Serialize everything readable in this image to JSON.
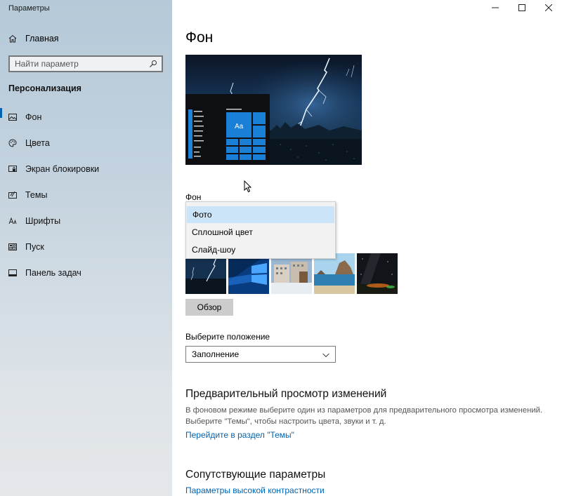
{
  "window": {
    "title": "Параметры",
    "controls": {
      "minimize": "—",
      "maximize": "☐",
      "close": "✕"
    }
  },
  "sidebar": {
    "home_label": "Главная",
    "search_placeholder": "Найти параметр",
    "section_heading": "Персонализация",
    "items": [
      {
        "label": "Фон",
        "icon": "picture-icon",
        "active": true
      },
      {
        "label": "Цвета",
        "icon": "palette-icon",
        "active": false
      },
      {
        "label": "Экран блокировки",
        "icon": "lock-screen-icon",
        "active": false
      },
      {
        "label": "Темы",
        "icon": "themes-icon",
        "active": false
      },
      {
        "label": "Шрифты",
        "icon": "fonts-icon",
        "active": false
      },
      {
        "label": "Пуск",
        "icon": "start-icon",
        "active": false
      },
      {
        "label": "Панель задач",
        "icon": "taskbar-icon",
        "active": false
      }
    ]
  },
  "main": {
    "title": "Фон",
    "preview_tile_text": "Aa",
    "background_label": "Фон",
    "background_options": [
      "Фото",
      "Сплошной цвет",
      "Слайд-шоу"
    ],
    "background_selected": "Фото",
    "browse_button": "Обзор",
    "fit_label": "Выберите положение",
    "fit_value": "Заполнение",
    "preview_changes_heading": "Предварительный просмотр изменений",
    "preview_changes_desc_1": "В фоновом режиме выберите один из параметров для предварительного просмотра изменений.",
    "preview_changes_desc_2": "Выберите \"Темы\", чтобы настроить цвета, звуки и т. д.",
    "themes_link": "Перейдите в раздел \"Темы\"",
    "related_heading": "Сопутствующие параметры",
    "high_contrast_link": "Параметры высокой контрастности"
  },
  "colors": {
    "accent": "#0063b1",
    "tile": "#1580d8",
    "link": "#0063b1"
  }
}
